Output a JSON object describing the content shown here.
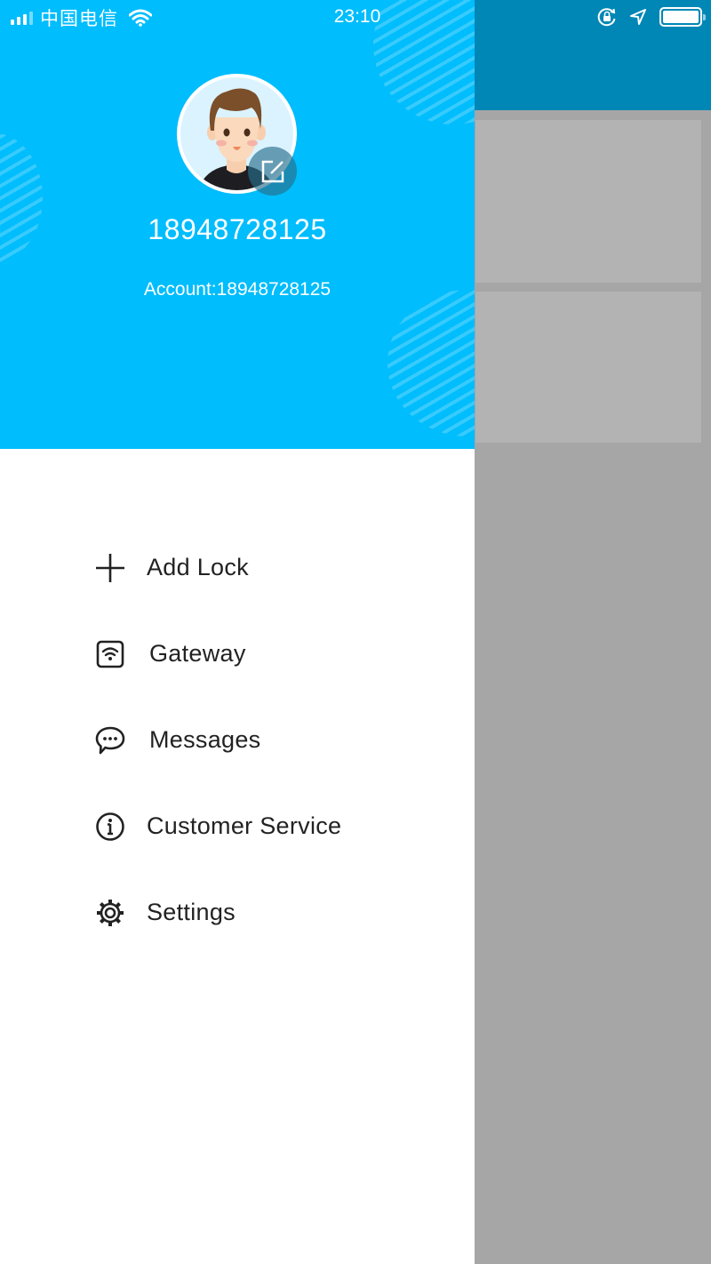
{
  "status_bar": {
    "carrier": "中国电信",
    "time": "23:10",
    "icons": [
      "signal-icon",
      "wifi-icon",
      "orientation-lock-icon",
      "location-icon",
      "battery-icon"
    ]
  },
  "drawer": {
    "profile": {
      "avatar": "avatar-cartoon-boy",
      "edit_icon": "edit-icon",
      "name": "18948728125",
      "account": "Account:18948728125"
    },
    "menu": [
      {
        "label": "Add Lock",
        "icon": "plus-icon"
      },
      {
        "label": "Gateway",
        "icon": "gateway-wifi-icon"
      },
      {
        "label": "Messages",
        "icon": "chat-bubble-icon"
      },
      {
        "label": "Customer Service",
        "icon": "info-icon"
      },
      {
        "label": "Settings",
        "icon": "gear-icon"
      }
    ]
  },
  "colors": {
    "drawer_header": "#00bdfd",
    "app_header": "#0087b5",
    "overlay": "#a6a6a6",
    "text_dark": "#222222"
  }
}
